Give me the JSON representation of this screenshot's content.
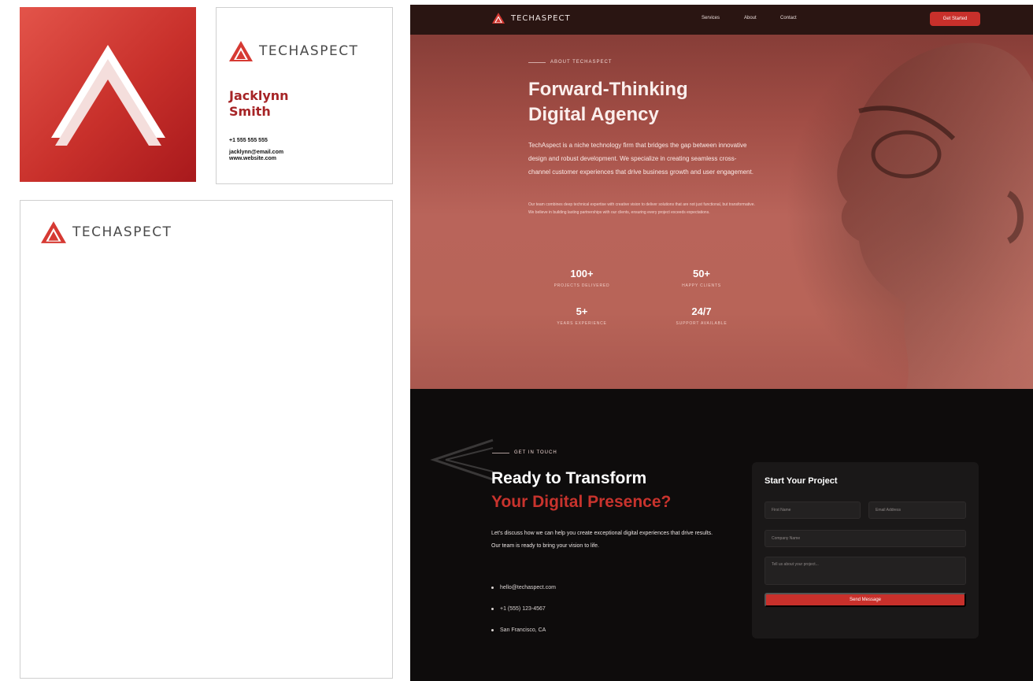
{
  "brand": {
    "name": "TECHASPECT",
    "accent": "#c8302b",
    "dark_red": "#a62426",
    "logo_icon": "triangle-logo-icon"
  },
  "business_card": {
    "name_line1": "Jacklynn",
    "name_line2": "Smith",
    "phone": "+1 555 555 555",
    "email": "jacklynn@email.com",
    "website": "www.website.com"
  },
  "website": {
    "nav": {
      "brand": "TECHASPECT",
      "links": [
        "Services",
        "About",
        "Contact"
      ],
      "cta": "Get Started"
    },
    "hero": {
      "eyebrow": "ABOUT TECHASPECT",
      "title_line1": "Forward-Thinking",
      "title_line2": "Digital Agency",
      "paragraph1": "TechAspect is a niche technology firm that bridges the gap between innovative design and robust development. We specialize in creating seamless cross-channel customer experiences that drive business growth and user engagement.",
      "paragraph2": "Our team combines deep technical expertise with creative vision to deliver solutions that are not just functional, but transformative. We believe in building lasting partnerships with our clients, ensuring every project exceeds expectations.",
      "stats": [
        {
          "value": "100+",
          "label": "PROJECTS DELIVERED"
        },
        {
          "value": "50+",
          "label": "HAPPY CLIENTS"
        },
        {
          "value": "5+",
          "label": "YEARS EXPERIENCE"
        },
        {
          "value": "24/7",
          "label": "SUPPORT AVAILABLE"
        }
      ]
    },
    "contact": {
      "eyebrow": "GET IN TOUCH",
      "title_line1": "Ready to Transform",
      "title_line2": "Your Digital Presence?",
      "text": "Let's discuss how we can help you create exceptional digital experiences that drive results. Our team is ready to bring your vision to life.",
      "items": [
        "hello@techaspect.com",
        "+1 (555) 123-4567",
        "San Francisco, CA"
      ],
      "form": {
        "title": "Start Your Project",
        "first_name": "First Name",
        "email": "Email Address",
        "company": "Company Name",
        "message": "Tell us about your project...",
        "submit": "Send Message"
      }
    }
  }
}
